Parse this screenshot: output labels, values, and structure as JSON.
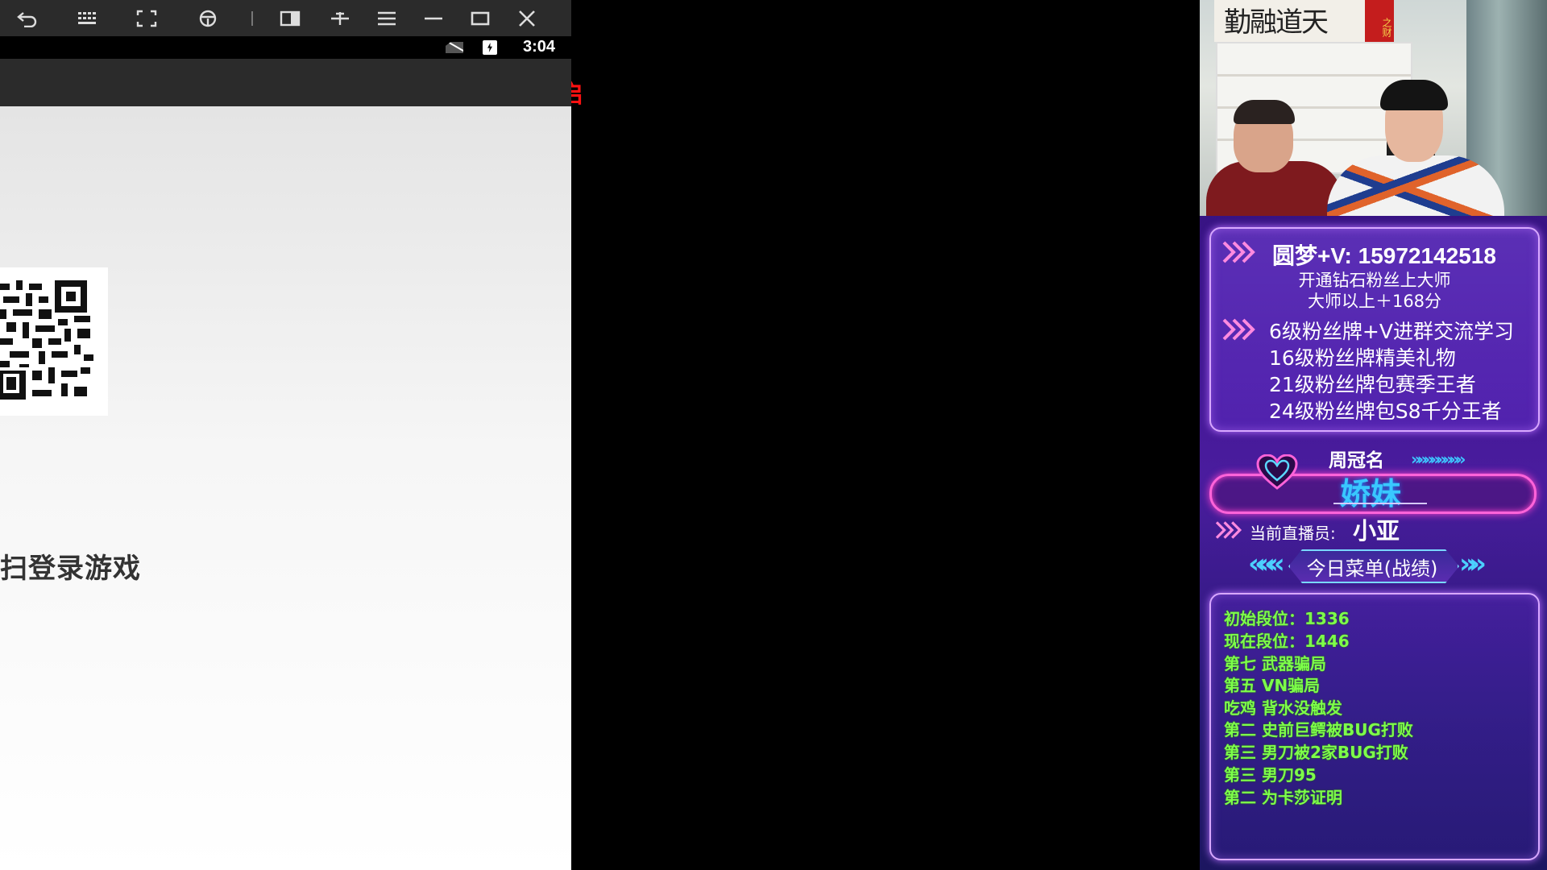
{
  "emulator": {
    "toolbar": {
      "buttons": [
        {
          "name": "back-icon",
          "label": "back"
        },
        {
          "name": "keyboard-icon",
          "label": "keyboard"
        },
        {
          "name": "fullscreen-icon",
          "label": "fullscreen"
        },
        {
          "name": "steering-icon",
          "label": "steering"
        },
        {
          "name": "window-icon",
          "label": "window"
        },
        {
          "name": "pin-icon",
          "label": "pin"
        },
        {
          "name": "menu-icon",
          "label": "menu"
        },
        {
          "name": "minimize-icon",
          "label": "minimize"
        },
        {
          "name": "maximize-icon",
          "label": "maximize"
        },
        {
          "name": "close-icon",
          "label": "close"
        }
      ]
    },
    "status": {
      "time": "3:04"
    },
    "login_text": "扫登录游戏"
  },
  "overlay_red_text": "启",
  "panel": {
    "promo": {
      "title": "圆梦+V: 15972142518",
      "subtitle1": "开通钻石粉丝上大师",
      "subtitle2": "大师以上＋168分",
      "items": [
        "6级粉丝牌+V进群交流学习",
        "16级粉丝牌精美礼物",
        "21级粉丝牌包赛季王者",
        "24级粉丝牌包S8千分王者"
      ]
    },
    "weekly": {
      "label": "周冠名",
      "chevrons": "»»»»»»»»",
      "name": "娇妹"
    },
    "streamer": {
      "label": "当前直播员:",
      "name": "小亚"
    },
    "menu_title": "今日菜单(战绩)",
    "menu_chev_left": "«««",
    "menu_chev_right": "»»",
    "records": [
      "初始段位：1336",
      "现在段位：1446",
      "第七  武器骗局",
      "第五  VN骗局",
      "吃鸡  背水没触发",
      "第二  史前巨鳄被BUG打败",
      "第三  男刀被2家BUG打败",
      "第三  男刀95",
      "第二  为卡莎证明"
    ],
    "camera": {
      "calligraphy": "勤融道天",
      "scroll": "之财"
    }
  },
  "colors": {
    "panel_purple": "#3a148a",
    "record_green": "#7dff4a",
    "weekly_name_blue": "#39c8ff",
    "neon_pink": "#ff63d9",
    "overlay_red": "#ff1111"
  }
}
